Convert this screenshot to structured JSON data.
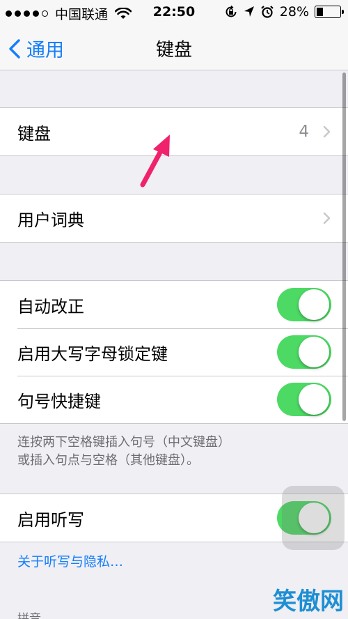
{
  "status_bar": {
    "carrier": "中国联通",
    "time": "22:50",
    "battery": "28%",
    "battery_level": 0.28
  },
  "nav": {
    "back_label": "通用",
    "title": "键盘"
  },
  "rows": {
    "keyboards": {
      "label": "键盘",
      "value": "4"
    },
    "user_dictionary": {
      "label": "用户词典"
    },
    "auto_correction": {
      "label": "自动改正",
      "on": true
    },
    "caps_lock": {
      "label": "启用大写字母锁定键",
      "on": true
    },
    "period_shortcut": {
      "label": "句号快捷键",
      "on": true
    },
    "dictation": {
      "label": "启用听写",
      "on": true
    }
  },
  "footer_note": {
    "line1": "连按两下空格键插入句号（中文键盘）",
    "line2": "或插入句点与空格（其他键盘）。"
  },
  "privacy_link": "关于听写与隐私…",
  "section_hint": "拼音",
  "watermark": "笑傲网",
  "colors": {
    "accent": "#157efb",
    "toggle_on": "#4cd964",
    "background": "#efeff4",
    "arrow": "#f0226b"
  }
}
